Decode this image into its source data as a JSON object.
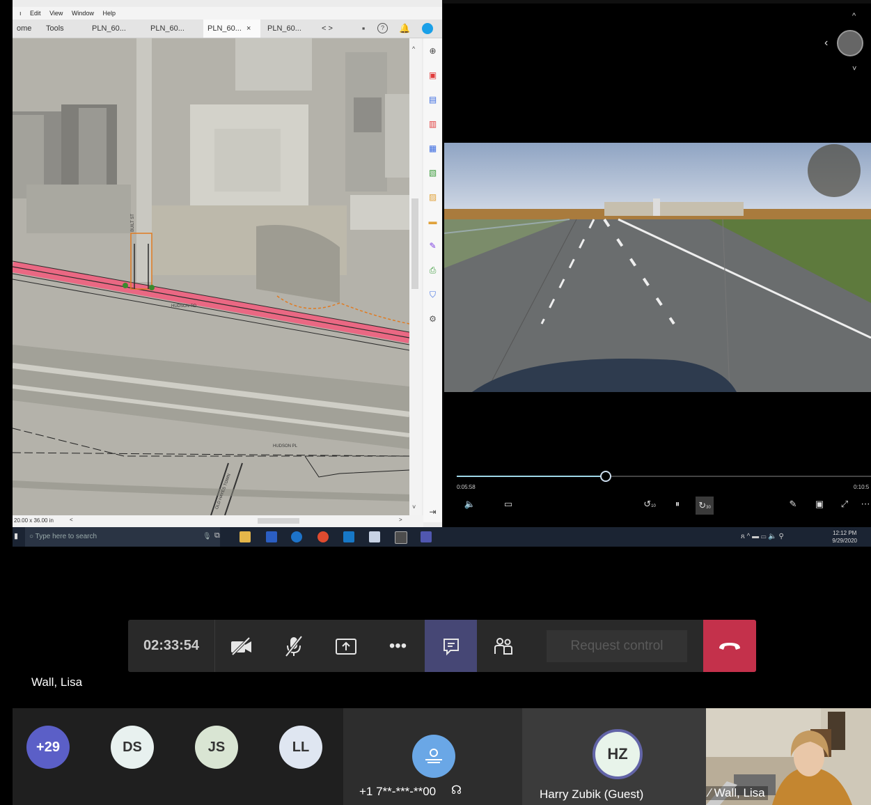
{
  "pdf_app": {
    "menu": [
      "Edit",
      "View",
      "Window",
      "Help"
    ],
    "menu_prefix": "ı",
    "tabs": [
      "ome",
      "Tools",
      "PLN_60...",
      "PLN_60...",
      "PLN_60...",
      "PLN_60..."
    ],
    "tab_close": "×",
    "nav_arrows": "< >",
    "map_labels": {
      "road1": "HUDSON RD",
      "road2": "HUDSON PL",
      "road3": "BUILT ST",
      "road4": "OLD HAYES TOWN"
    },
    "page_size": "20.00 x 36.00 in",
    "scroll_left": "<",
    "scroll_right": ">"
  },
  "video_player": {
    "current_time": "0:05:58",
    "duration": "0:10:5",
    "progress_fraction": 0.36,
    "skip_back_label": "10",
    "skip_forward_label": "30"
  },
  "taskbar": {
    "search_placeholder": "Type here to search",
    "time": "12:12 PM",
    "date": "9/29/2020"
  },
  "meeting": {
    "elapsed": "02:33:54",
    "request_control_label": "Request control",
    "presenter_name": "Wall, Lisa",
    "colors": {
      "hangup": "#c4314b",
      "active_button": "#464775"
    }
  },
  "participants": {
    "overflow_count": "+29",
    "avatars": [
      {
        "initials": "DS",
        "color": "#e8f1ef"
      },
      {
        "initials": "JS",
        "color": "#d9e5d3"
      },
      {
        "initials": "LL",
        "color": "#dfe6f1"
      }
    ],
    "phone_caller": "+1 7**-***-**00",
    "guest_initials": "HZ",
    "guest_name": "Harry Zubik (Guest)",
    "video_name": "Wall, Lisa"
  }
}
